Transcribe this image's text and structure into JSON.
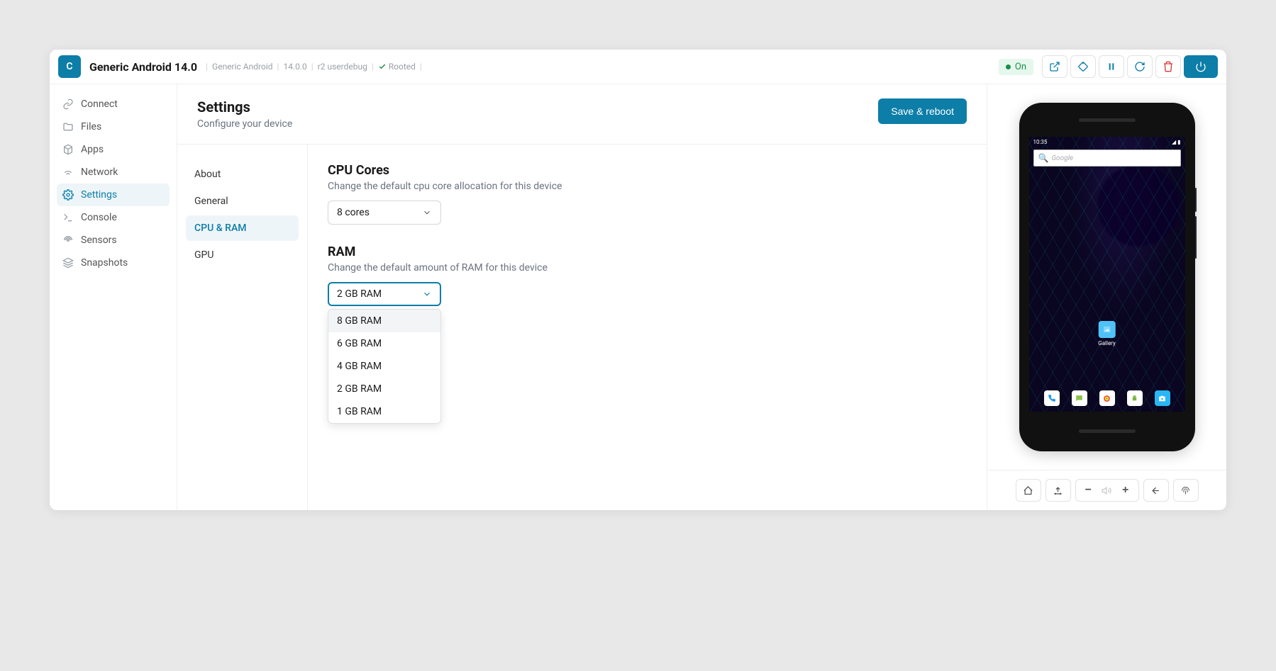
{
  "titlebar": {
    "app_letter": "C",
    "title": "Generic Android 14.0",
    "device": "Generic Android",
    "version": "14.0.0",
    "build": "r2 userdebug",
    "rooted": "Rooted",
    "status": "On"
  },
  "sidebar": {
    "items": [
      {
        "label": "Connect"
      },
      {
        "label": "Files"
      },
      {
        "label": "Apps"
      },
      {
        "label": "Network"
      },
      {
        "label": "Settings"
      },
      {
        "label": "Console"
      },
      {
        "label": "Sensors"
      },
      {
        "label": "Snapshots"
      }
    ]
  },
  "page": {
    "title": "Settings",
    "subtitle": "Configure your device",
    "save_label": "Save & reboot"
  },
  "tabs": [
    {
      "label": "About"
    },
    {
      "label": "General"
    },
    {
      "label": "CPU & RAM"
    },
    {
      "label": "GPU"
    }
  ],
  "cpu": {
    "title": "CPU Cores",
    "desc": "Change the default cpu core allocation for this device",
    "value": "8 cores"
  },
  "ram": {
    "title": "RAM",
    "desc": "Change the default amount of RAM for this device",
    "value": "2 GB RAM",
    "options": [
      "8 GB RAM",
      "6 GB RAM",
      "4 GB RAM",
      "2 GB RAM",
      "1 GB RAM"
    ]
  },
  "phone": {
    "time": "10:35",
    "search_placeholder": "Google",
    "gallery_label": "Gallery"
  }
}
